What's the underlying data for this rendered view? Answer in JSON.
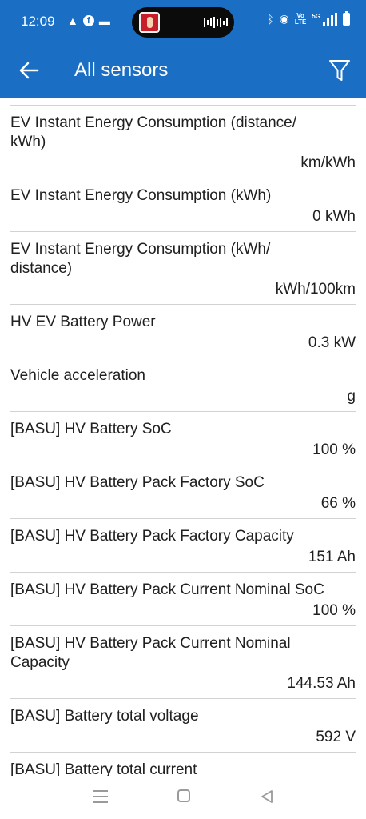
{
  "status_bar": {
    "time": "12:09",
    "volte_top": "Vo",
    "volte_bottom": "LTE",
    "network": "5G"
  },
  "app_bar": {
    "title": "All sensors",
    "back_icon": "arrow-left-icon",
    "filter_icon": "filter-icon"
  },
  "sensors": [
    {
      "name": "EV Instant Energy Consumption (distance/\nkWh)",
      "value": "km/kWh"
    },
    {
      "name": "EV Instant Energy Consumption (kWh)",
      "value": "0 kWh"
    },
    {
      "name": "EV Instant Energy Consumption (kWh/\ndistance)",
      "value": "kWh/100km"
    },
    {
      "name": "HV EV Battery Power",
      "value": "0.3 kW"
    },
    {
      "name": "Vehicle acceleration",
      "value": "g"
    },
    {
      "name": "[BASU] HV Battery SoC",
      "value": "100 %"
    },
    {
      "name": "[BASU] HV Battery Pack Factory SoC",
      "value": "66 %"
    },
    {
      "name": "[BASU] HV Battery Pack Factory Capacity",
      "value": "151 Ah"
    },
    {
      "name": "[BASU] HV Battery Pack Current Nominal SoC",
      "value": "100 %"
    },
    {
      "name": "[BASU] HV Battery Pack Current Nominal\nCapacity",
      "value": "144.53 Ah"
    },
    {
      "name": "[BASU] Battery total voltage",
      "value": "592 V"
    },
    {
      "name": "[BASU] Battery total current",
      "value": ""
    }
  ],
  "colors": {
    "accent": "#1a6fc4",
    "divider": "#d2d2d2",
    "text": "#202020"
  }
}
